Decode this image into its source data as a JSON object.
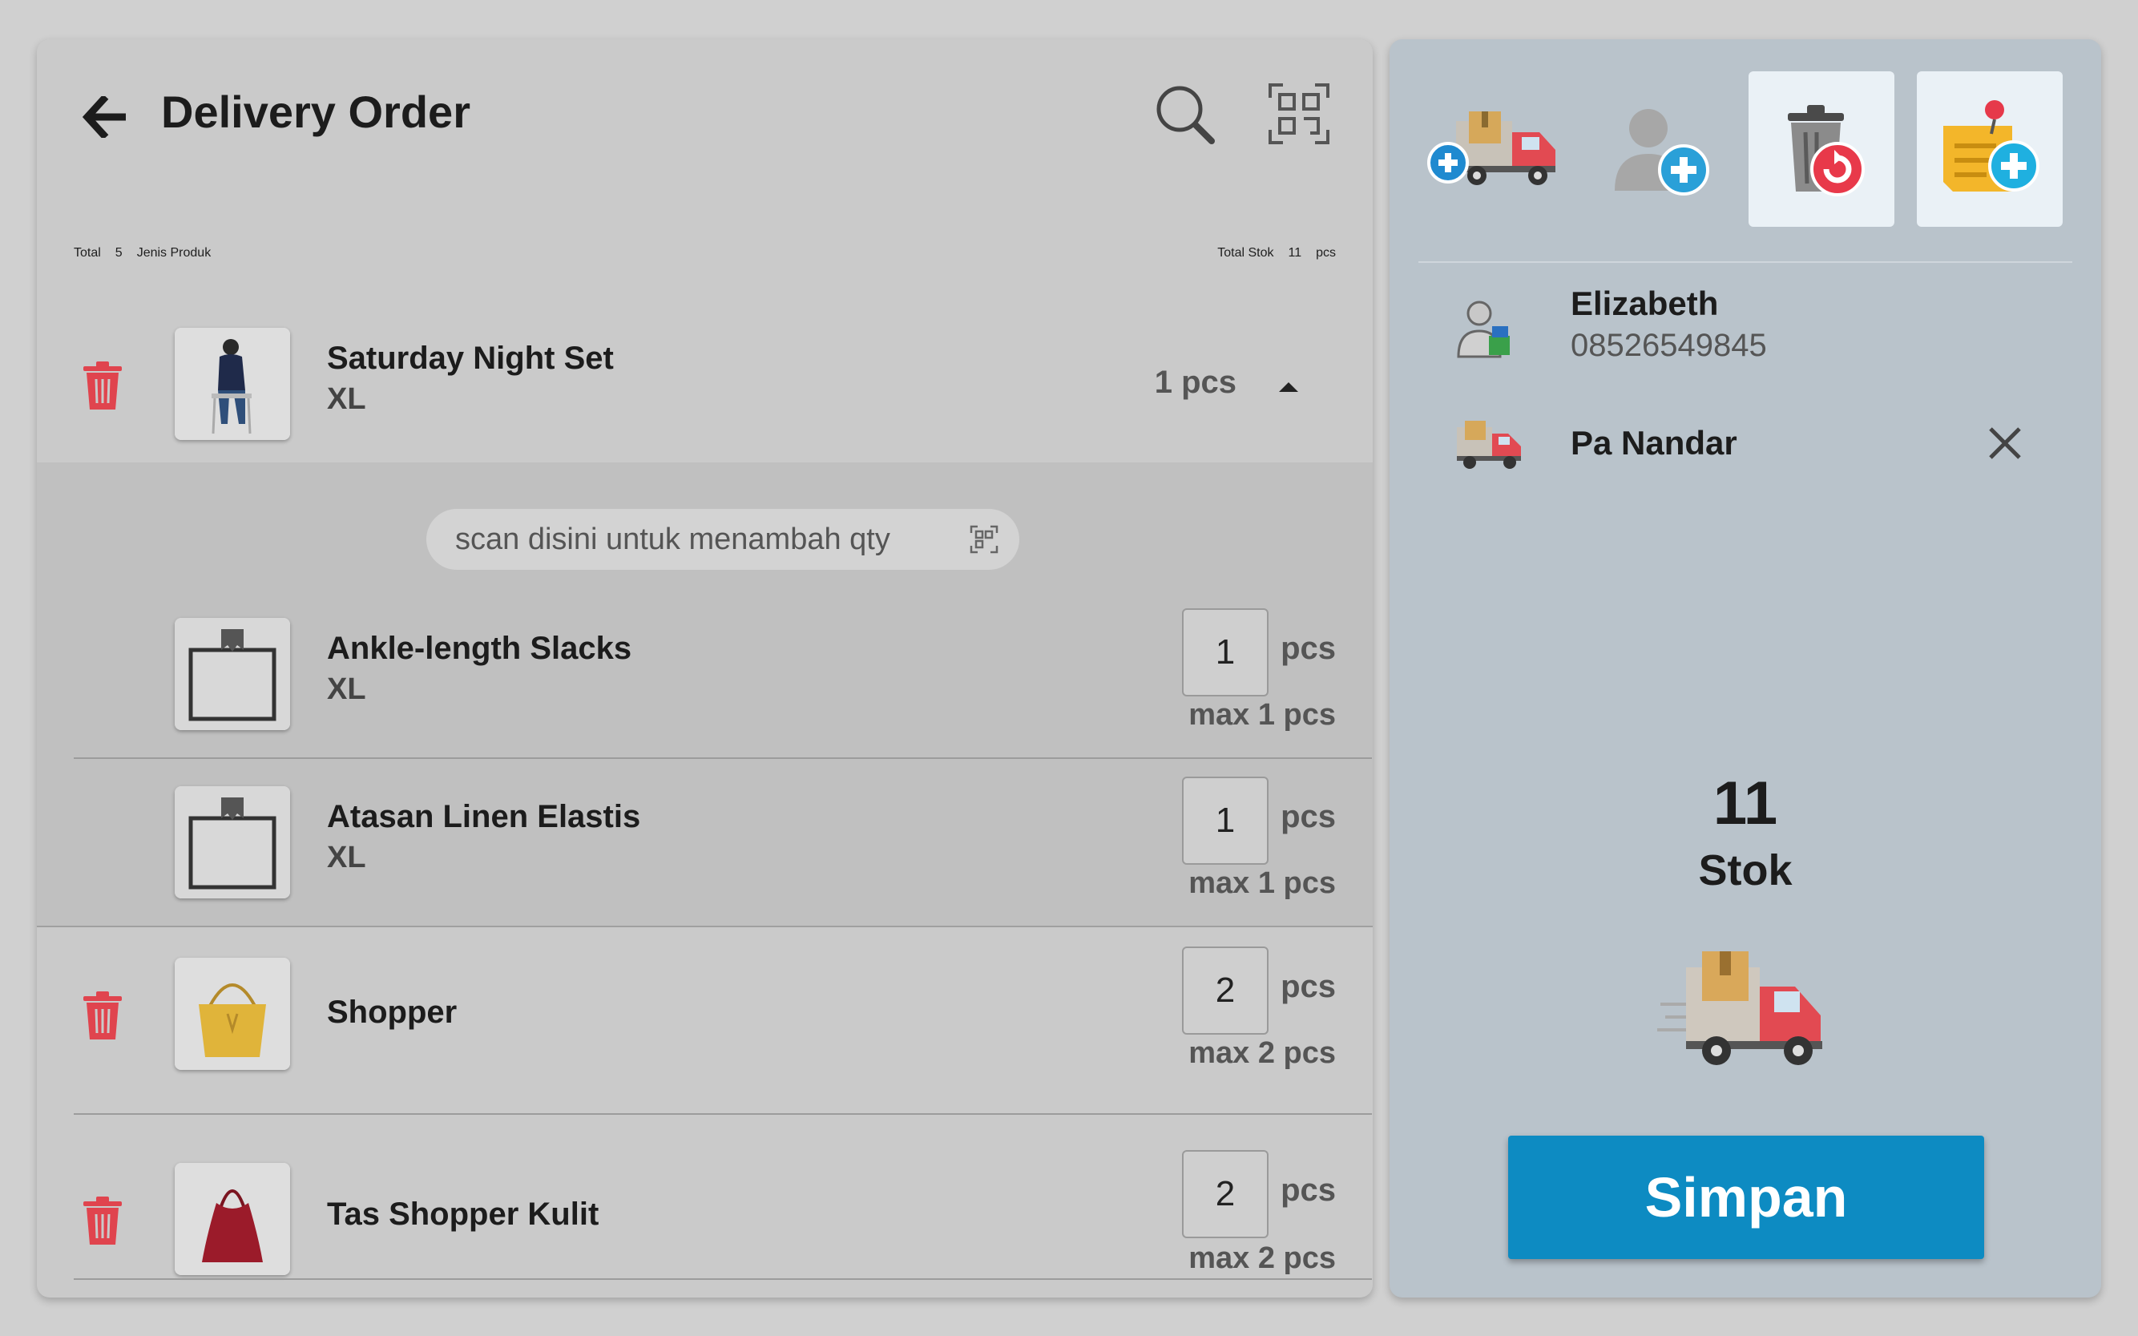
{
  "header": {
    "title": "Delivery Order"
  },
  "summary": {
    "total_label": "Total",
    "total_count": "5",
    "total_suffix": "Jenis Produk",
    "stock_label": "Total Stok",
    "stock_count": "11",
    "stock_unit": "pcs"
  },
  "scan_hint": "scan disini untuk menambah qty",
  "items": [
    {
      "name": "Saturday Night Set",
      "variant": "XL",
      "qty": "1 pcs"
    },
    {
      "name": "Ankle-length Slacks",
      "variant": "XL",
      "qty": "1",
      "unit": "pcs",
      "max": "max 1 pcs"
    },
    {
      "name": "Atasan Linen Elastis",
      "variant": "XL",
      "qty": "1",
      "unit": "pcs",
      "max": "max 1 pcs"
    },
    {
      "name": "Shopper",
      "variant": "",
      "qty": "2",
      "unit": "pcs",
      "max": "max 2 pcs"
    },
    {
      "name": "Tas Shopper Kulit",
      "variant": "",
      "qty": "2",
      "unit": "pcs",
      "max": "max 2 pcs"
    }
  ],
  "customer": {
    "name": "Elizabeth",
    "phone": "08526549845"
  },
  "driver": {
    "name": "Pa Nandar"
  },
  "stock": {
    "count": "11",
    "label": "Stok"
  },
  "actions": {
    "save_label": "Simpan"
  },
  "icons": {
    "back": "arrow-left-icon",
    "search": "search-icon",
    "scan": "qr-scan-icon",
    "trash": "trash-icon",
    "add_delivery": "truck-add-icon",
    "add_customer": "user-add-icon",
    "restore_trash": "trash-restore-icon",
    "add_note": "note-add-icon"
  },
  "colors": {
    "accent": "#0d8bc2",
    "trash": "#e0444e",
    "right_panel": "#b9c3cb"
  }
}
